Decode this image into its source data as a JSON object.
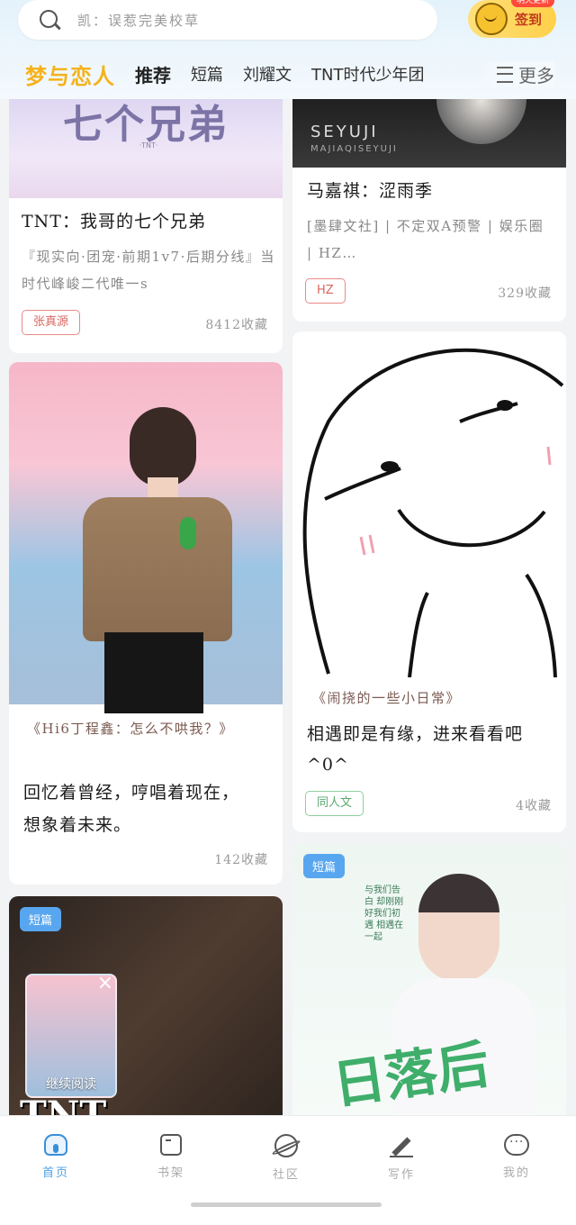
{
  "search": {
    "placeholder": "凯：误惹完美校草"
  },
  "checkin": {
    "label": "签到",
    "badge": "明天更新"
  },
  "nav": {
    "brand": "梦与恋人",
    "tabs": [
      "推荐",
      "短篇",
      "刘耀文",
      "TNT时代少年团"
    ],
    "more_label": "更多"
  },
  "cards": {
    "c1": {
      "cover_big": "七个兄弟",
      "cover_small": "·TNT·",
      "title": "TNT：我哥的七个兄弟",
      "desc": "『现实向·团宠·前期1v7·后期分线』当时代峰峻二代唯一s",
      "tag": "张真源",
      "count": "8412收藏"
    },
    "c2": {
      "cover_t": "SEYUJI",
      "cover_s": "MAJIAQISEYUJI",
      "title": "马嘉祺：涩雨季",
      "desc": "[墨肆文社] | 不定双A预警 | 娱乐圈 | HZ…",
      "tag": "HZ",
      "count": "329收藏"
    },
    "c3": {
      "subtitle": "《Hi6丁程鑫：怎么不哄我？》",
      "title": "回忆着曾经，哼唱着现在，想象着未来。",
      "count": "142收藏"
    },
    "c4": {
      "subtitle": "《闹挠的一些小日常》",
      "title": "相遇即是有缘，进来看看吧^0^",
      "tag": "同人文",
      "count": "4收藏"
    },
    "c5": {
      "corner": "短篇",
      "continue_label": "继续阅读",
      "cover_text": "TNT"
    },
    "c6": {
      "corner": "短篇",
      "cover_text": "日落后",
      "cover_vertical": "与我们告白 却刚刚好我们初遇 相遇在一起"
    }
  },
  "tabbar": {
    "items": [
      {
        "label": "首页",
        "icon": "home-icon",
        "active": true
      },
      {
        "label": "书架",
        "icon": "bookshelf-icon",
        "active": false
      },
      {
        "label": "社区",
        "icon": "planet-icon",
        "active": false
      },
      {
        "label": "写作",
        "icon": "pen-icon",
        "active": false
      },
      {
        "label": "我的",
        "icon": "chat-icon",
        "active": false
      }
    ]
  },
  "colors": {
    "accent": "#4da2e8",
    "brand": "#f5b21c",
    "tag_red": "#d8665f",
    "tag_green": "#5aa86d"
  }
}
